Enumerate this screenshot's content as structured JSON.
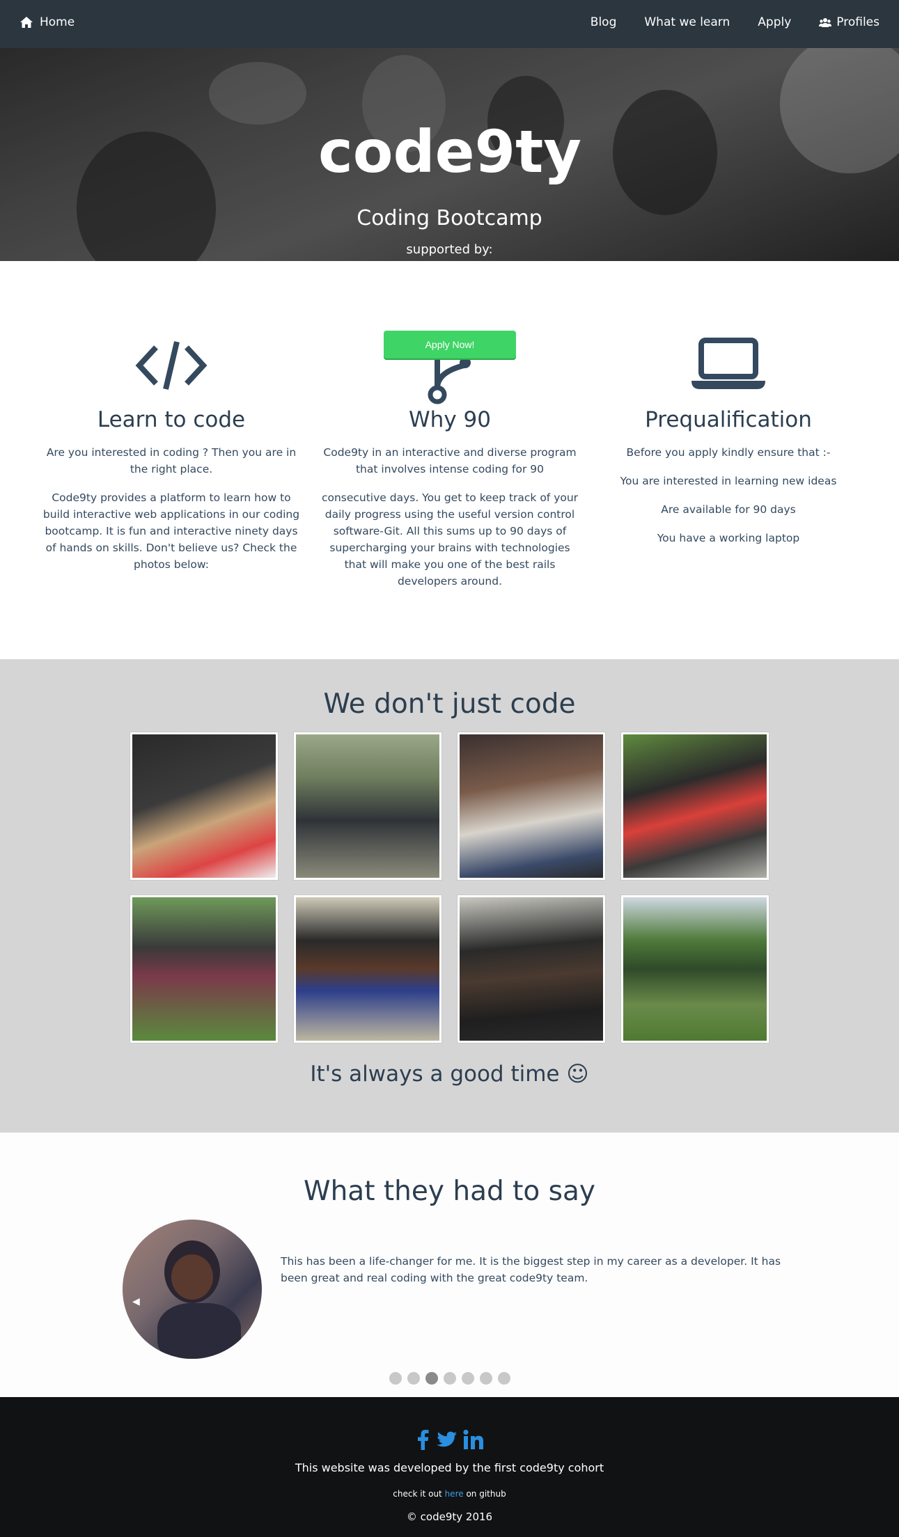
{
  "nav": {
    "home_label": "Home",
    "links": [
      "Blog",
      "What we learn",
      "Apply"
    ],
    "profiles_label": "Profiles"
  },
  "hero": {
    "logo_text": "code9ty",
    "subtitle": "Coding Bootcamp",
    "supported_by": "supported by:"
  },
  "features": [
    {
      "icon": "code-icon",
      "title": "Learn to code",
      "paragraphs": [
        "Are you interested in coding ? Then you are in the right place.",
        "Code9ty provides a platform to learn how to build interactive web applications in our coding bootcamp. It is fun and interactive ninety days of hands on skills. Don't believe us? Check the photos below:"
      ]
    },
    {
      "icon": "git-branch-icon",
      "title": "Why 90",
      "paragraphs": [
        "Code9ty in an interactive and diverse program that involves intense coding for 90",
        "consecutive days. You get to keep track of your daily progress using the useful version control software-Git. All this sums up to 90 days of supercharging your brains with technologies that will make you one of the best rails developers around."
      ]
    },
    {
      "icon": "laptop-icon",
      "title": "Prequalification",
      "paragraphs": [
        "Before you apply kindly ensure that :-",
        "You are interested in learning new ideas",
        "Are available for 90 days",
        "You have a working laptop"
      ]
    }
  ],
  "apply_button": "Apply Now!",
  "gallery": {
    "title": "We don't just code",
    "caption": "It's always a good time ☺"
  },
  "testimonials": {
    "title": "What they had to say",
    "quote": "This has been a life-changer for me. It is the biggest step in my career as a developer. It has been great and real coding with the great code9ty team.",
    "prev_arrow": "◀",
    "dot_count": 7,
    "active_dot": 2
  },
  "footer": {
    "social": [
      "facebook-icon",
      "twitter-icon",
      "linkedin-icon"
    ],
    "credit": "This website was developed by the first code9ty cohort",
    "github_prefix": "check it out",
    "github_link": "here",
    "github_suffix": "on github",
    "copyright": "© code9ty 2016"
  },
  "colors": {
    "navbar": "#2b363f",
    "heading": "#2c3e50",
    "apply_green": "#3fd466",
    "gallery_bg": "#d5d5d5",
    "footer_bg": "#111213",
    "link_blue": "#3aa0e6",
    "social_blue": "#2a8fe0"
  }
}
